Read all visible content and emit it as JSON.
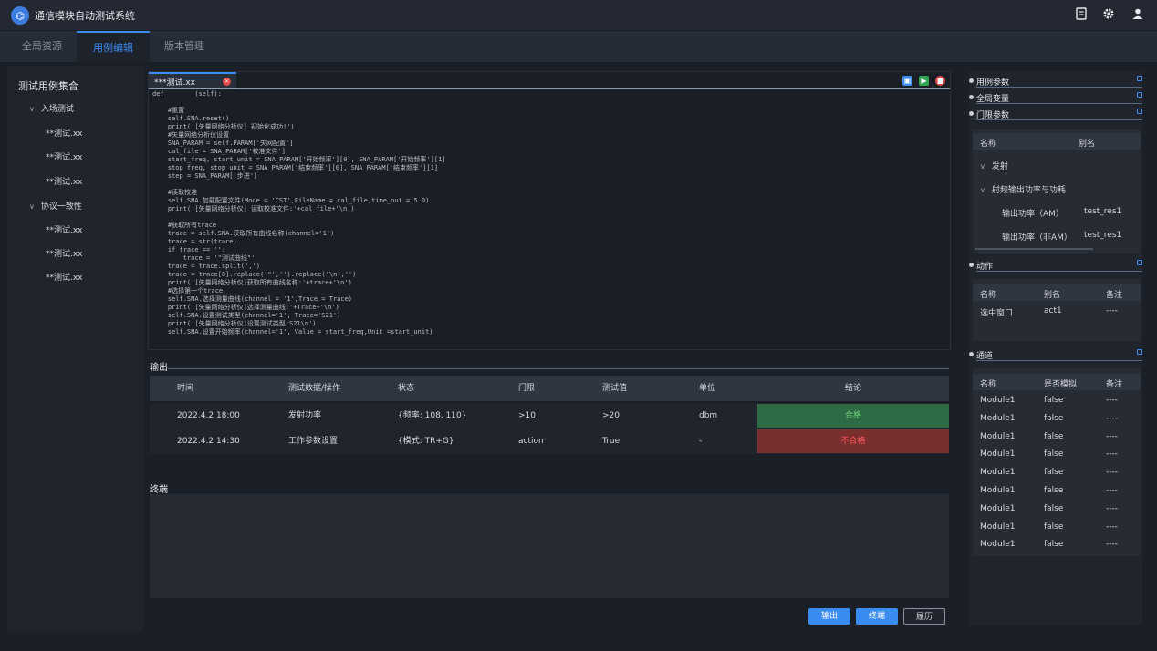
{
  "app": {
    "title": "通信模块自动测试系统",
    "logo_glyph": "⌬"
  },
  "top_icons": [
    "report-icon",
    "gear-icon",
    "user-icon"
  ],
  "main_tabs": [
    {
      "label": "全局资源"
    },
    {
      "label": "用例编辑"
    },
    {
      "label": "版本管理"
    }
  ],
  "sidebar": {
    "title": "测试用例集合",
    "groups": [
      {
        "label": "入场测试",
        "items": [
          "**测试.xx",
          "**测试.xx",
          "**测试.xx"
        ]
      },
      {
        "label": "协议一致性",
        "items": [
          "**测试.xx",
          "**测试.xx",
          "**测试.xx"
        ]
      }
    ]
  },
  "editor": {
    "tab_label": "***测试.xx",
    "code": "def        (self):\n\n    #重置\n    self.SNA.reset()\n    print('[矢量网络分析仪] 初始化成功!')\n    #矢量网络分析仪设置\n    SNA_PARAM = self.PARAM['矢网配置']\n    cal_file = SNA_PARAM['校准文件']\n    start_freq, start_unit = SNA_PARAM['开始频率'][0], SNA_PARAM['开始频率'][1]\n    stop_freq, stop_unit = SNA_PARAM['结束频率'][0], SNA_PARAM['结束频率'][1]\n    step = SNA_PARAM['步进']\n\n    #读取校准\n    self.SNA.加载配置文件(Mode = 'CST',FileName = cal_file,time_out = 5.0)\n    print('[矢量网络分析仪] 读取校准文件:'+cal_file+'\\n')\n\n    #获取所有trace\n    trace = self.SNA.获取所有曲线名称(channel='1')\n    trace = str(trace)\n    if trace == '':\n        trace = '\"测试曲线\"'\n    trace = trace.split(',')\n    trace = trace[0].replace('\"','').replace('\\n','')\n    print('[矢量网络分析仪]获取所有曲线名称:'+trace+'\\n')\n    #选择第一个trace\n    self.SNA.选择测量曲线(channel = '1',Trace = Trace)\n    print('[矢量网络分析仪]选择测量曲线:'+Trace+'\\n')\n    self.SNA.设置测试类型(channel='1', Trace='S21')\n    print('[矢量网络分析仪]设置测试类型:S21\\n')\n    self.SNA.设置开始频率(channel='1', Value = start_freq,Unit =start_unit)"
  },
  "output": {
    "label": "输出",
    "headers": [
      "时间",
      "测试数据/操作",
      "状态",
      "门限",
      "测试值",
      "单位",
      "结论"
    ],
    "rows": [
      {
        "time": "2022.4.2 18:00",
        "op": "发射功率",
        "status": "{频率: 108, 110}",
        "threshold": ">10",
        "value": ">20",
        "unit": "dbm",
        "result": "合格",
        "result_bg": "#2e6b44",
        "result_fg": "#6fd17c"
      },
      {
        "time": "2022.4.2 14:30",
        "op": "工作参数设置",
        "status": "{模式: TR+G}",
        "threshold": "action",
        "value": "True",
        "unit": "-",
        "result": "不合格",
        "result_bg": "#7a2f2f",
        "result_fg": "#ff5a5a"
      }
    ]
  },
  "terminal": {
    "label": "终端"
  },
  "buttons": {
    "output": "输出",
    "terminal": "终端",
    "history": "履历"
  },
  "right_panel": {
    "sections": [
      "用例参数",
      "全局变量",
      "门限参数",
      "动作",
      "通道"
    ],
    "threshold": {
      "headers": [
        "名称",
        "别名"
      ],
      "nodes": [
        "发射",
        "射频输出功率与功耗"
      ],
      "rows": [
        {
          "name": "输出功率（AM）",
          "alias": "test_res1"
        },
        {
          "name": "输出功率（非AM）",
          "alias": "test_res1"
        }
      ]
    },
    "action": {
      "headers": [
        "名称",
        "别名",
        "备注"
      ],
      "rows": [
        {
          "name": "选中窗口",
          "alias": "act1",
          "note": "----"
        }
      ]
    },
    "channel": {
      "headers": [
        "名称",
        "是否模拟",
        "备注"
      ],
      "rows": [
        {
          "name": "Module1",
          "sim": "false",
          "note": "----"
        },
        {
          "name": "Module1",
          "sim": "false",
          "note": "----"
        },
        {
          "name": "Module1",
          "sim": "false",
          "note": "----"
        },
        {
          "name": "Module1",
          "sim": "false",
          "note": "----"
        },
        {
          "name": "Module1",
          "sim": "false",
          "note": "----"
        },
        {
          "name": "Module1",
          "sim": "false",
          "note": "----"
        },
        {
          "name": "Module1",
          "sim": "false",
          "note": "----"
        },
        {
          "name": "Module1",
          "sim": "false",
          "note": "----"
        },
        {
          "name": "Module1",
          "sim": "false",
          "note": "----"
        }
      ]
    }
  },
  "colors": {
    "accent": "#3a8cf0",
    "pass_bg": "#2e6b44",
    "fail_bg": "#7a2f2f"
  }
}
